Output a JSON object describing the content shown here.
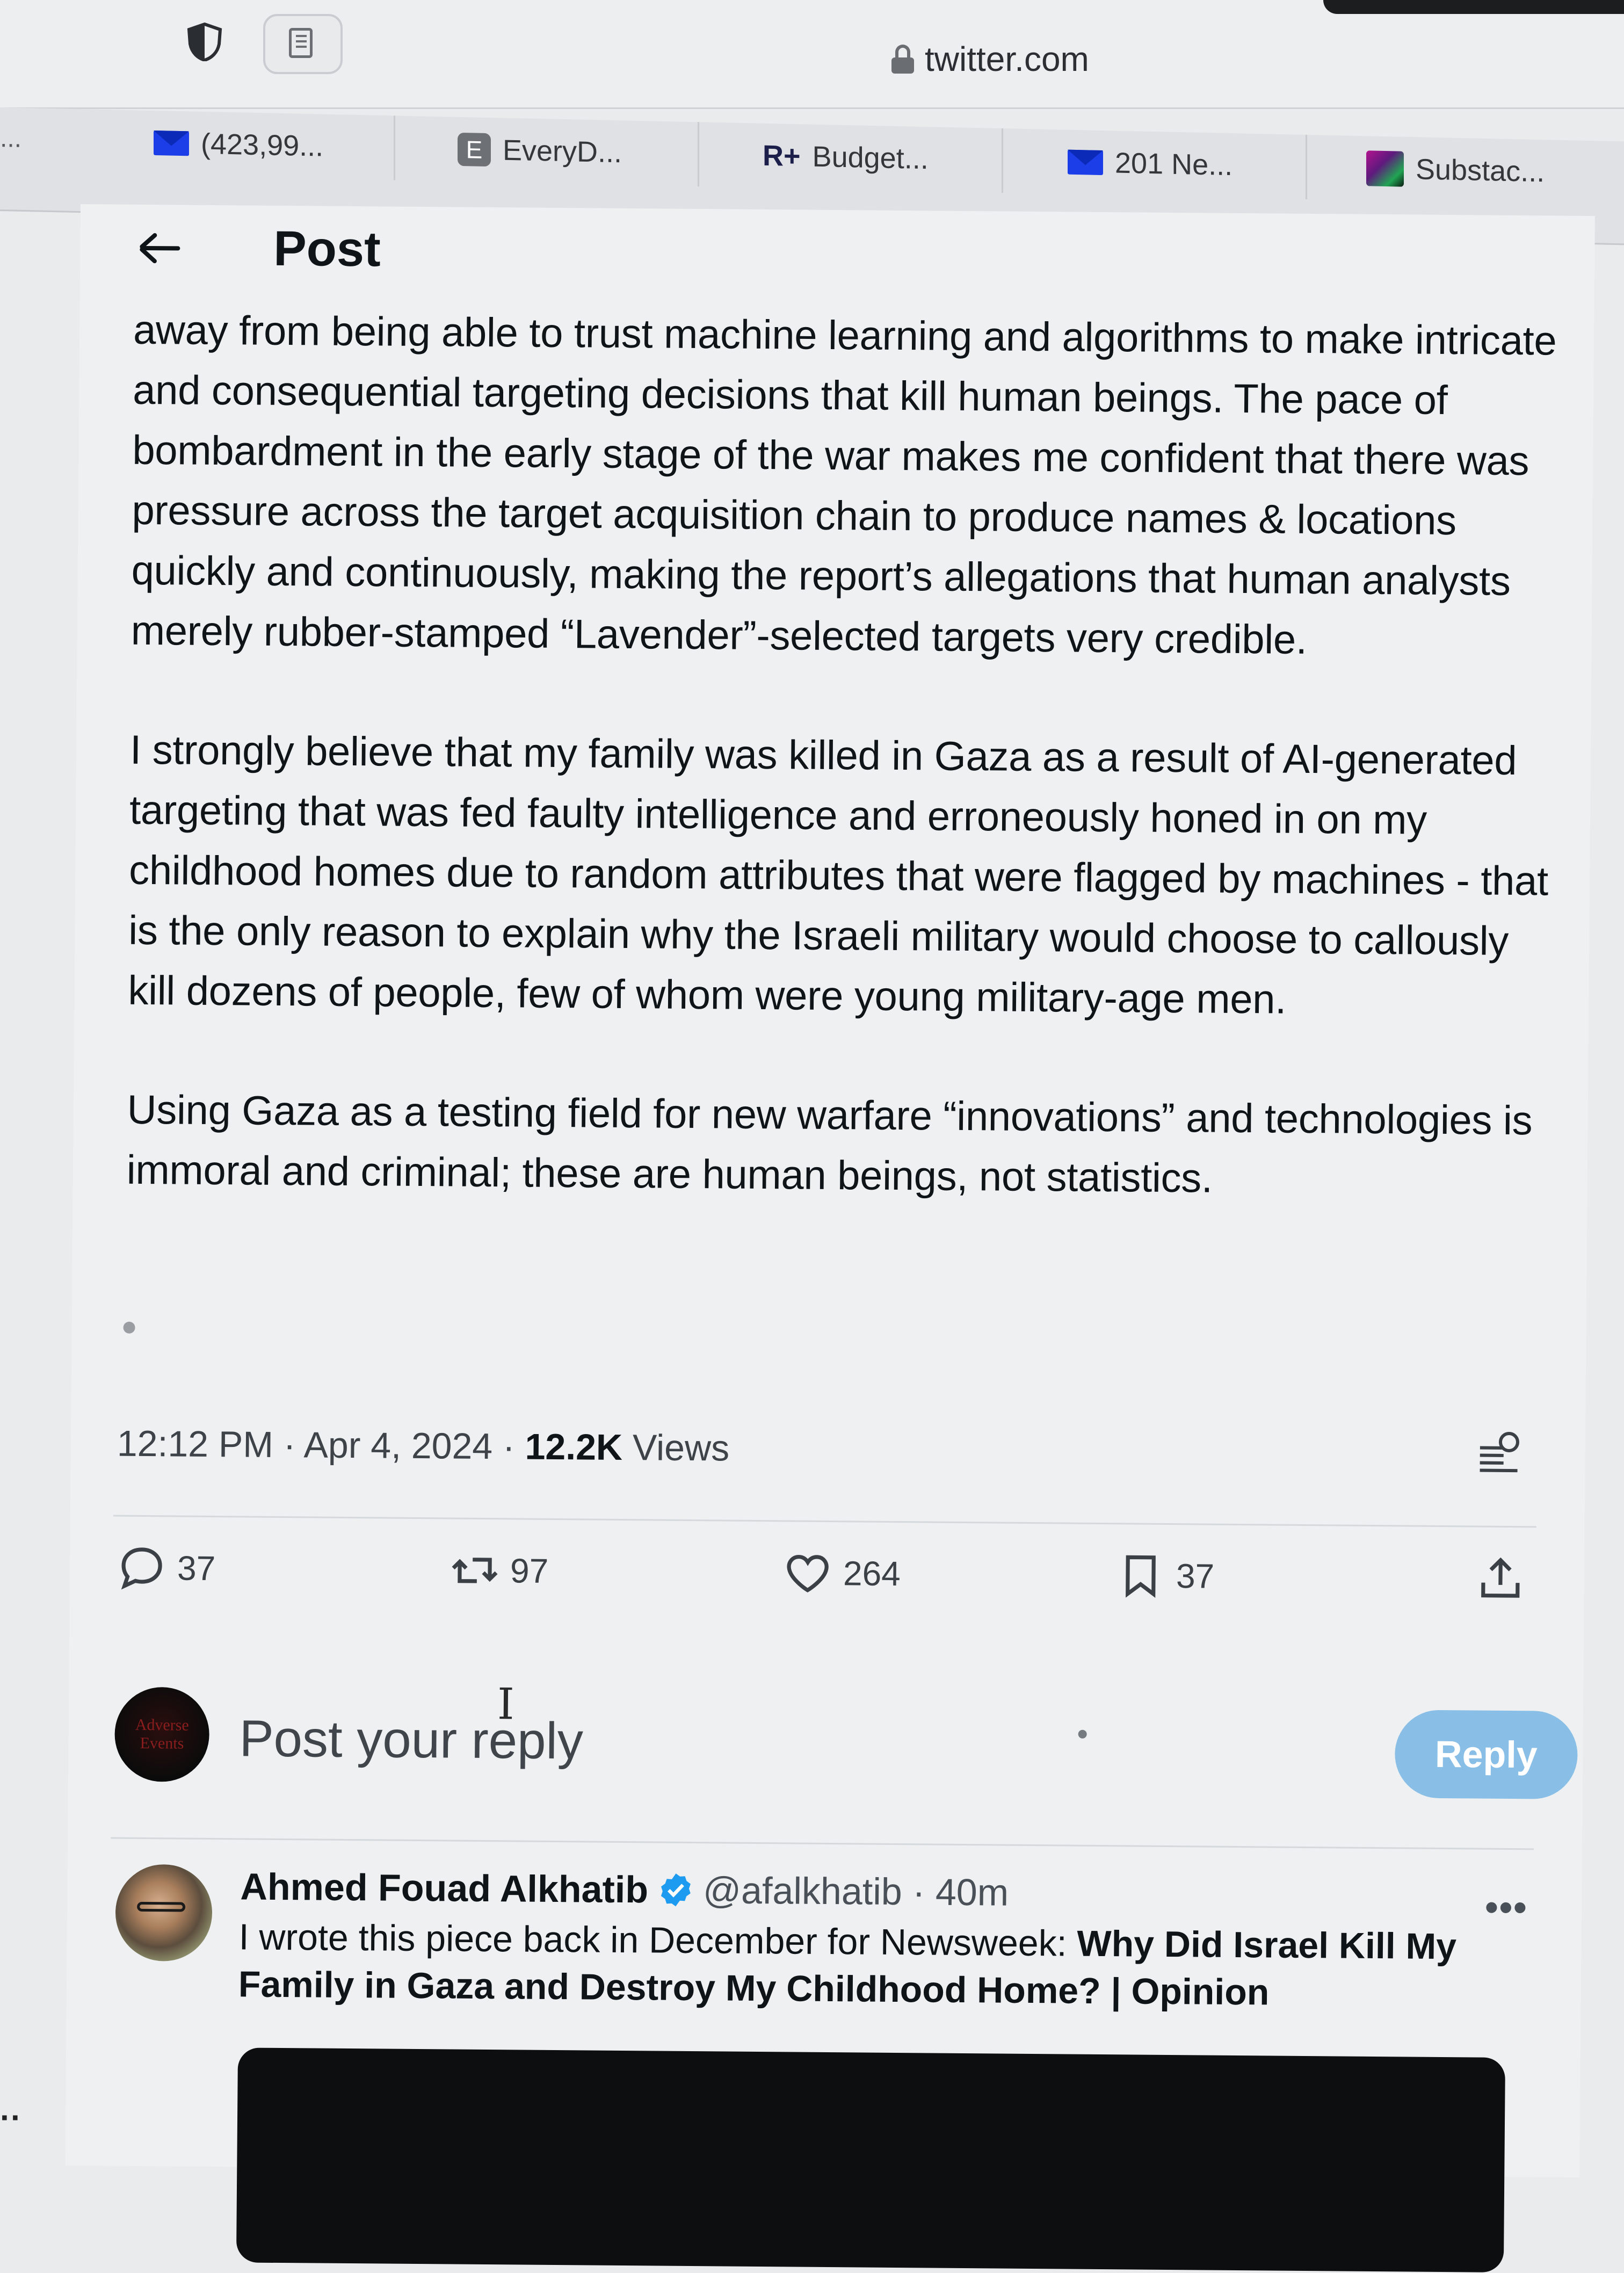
{
  "browser": {
    "url": "twitter.com",
    "overflow": "...",
    "tabs": [
      {
        "label": "(423,99...",
        "icon": "mail-icon"
      },
      {
        "label": "EveryD...",
        "icon": "every-icon",
        "icon_letter": "E"
      },
      {
        "label": "Budget...",
        "icon": "rocket-money-icon",
        "icon_letter": "R+"
      },
      {
        "label": "201 Ne...",
        "icon": "mail-icon"
      },
      {
        "label": "Substac...",
        "icon": "substack-icon"
      }
    ]
  },
  "header": {
    "title": "Post"
  },
  "post": {
    "paragraphs": [
      "away from being able to trust machine learning and algorithms to make intricate and consequential targeting decisions that kill human beings. The pace of bombardment in the early stage of the war makes me confident that there was pressure across the target acquisition chain to produce names & locations quickly and continuously, making the report’s allegations that human analysts merely rubber-stamped “Lavender”-selected targets very credible.",
      "I strongly believe that my family was killed in Gaza as a result of AI-generated targeting that was fed faulty intelligence and erroneously honed in on my childhood homes due to random attributes that were flagged by machines - that is the only reason to explain why the Israeli military would choose to callously kill dozens of people, few of whom were young military-age men.",
      "Using Gaza as a testing field for new warfare “innovations” and technologies is immoral and criminal; these are human beings, not statistics."
    ],
    "timestamp": "12:12 PM · Apr 4, 2024 · ",
    "views_count": "12.2K",
    "views_label": " Views",
    "stats": {
      "replies": "37",
      "reposts": "97",
      "likes": "264",
      "bookmarks": "37"
    }
  },
  "compose": {
    "avatar_text_1": "Adverse",
    "avatar_text_2": "Events",
    "placeholder": "Post your reply",
    "reply_label": "Reply"
  },
  "reply": {
    "author": "Ahmed Fouad Alkhatib",
    "handle": "@afalkhatib · 40m",
    "more": "•••",
    "text_plain": "I wrote this piece back in December for Newsweek: ",
    "text_link": "Why Did Israel Kill My Family in Gaza and Destroy My Childhood Home? | Opinion"
  },
  "colors": {
    "page_bg": "#eef0f1",
    "reply_button": "#89bfe6",
    "verified": "#1d9bf0",
    "mail_icon": "#1c3ee8"
  }
}
